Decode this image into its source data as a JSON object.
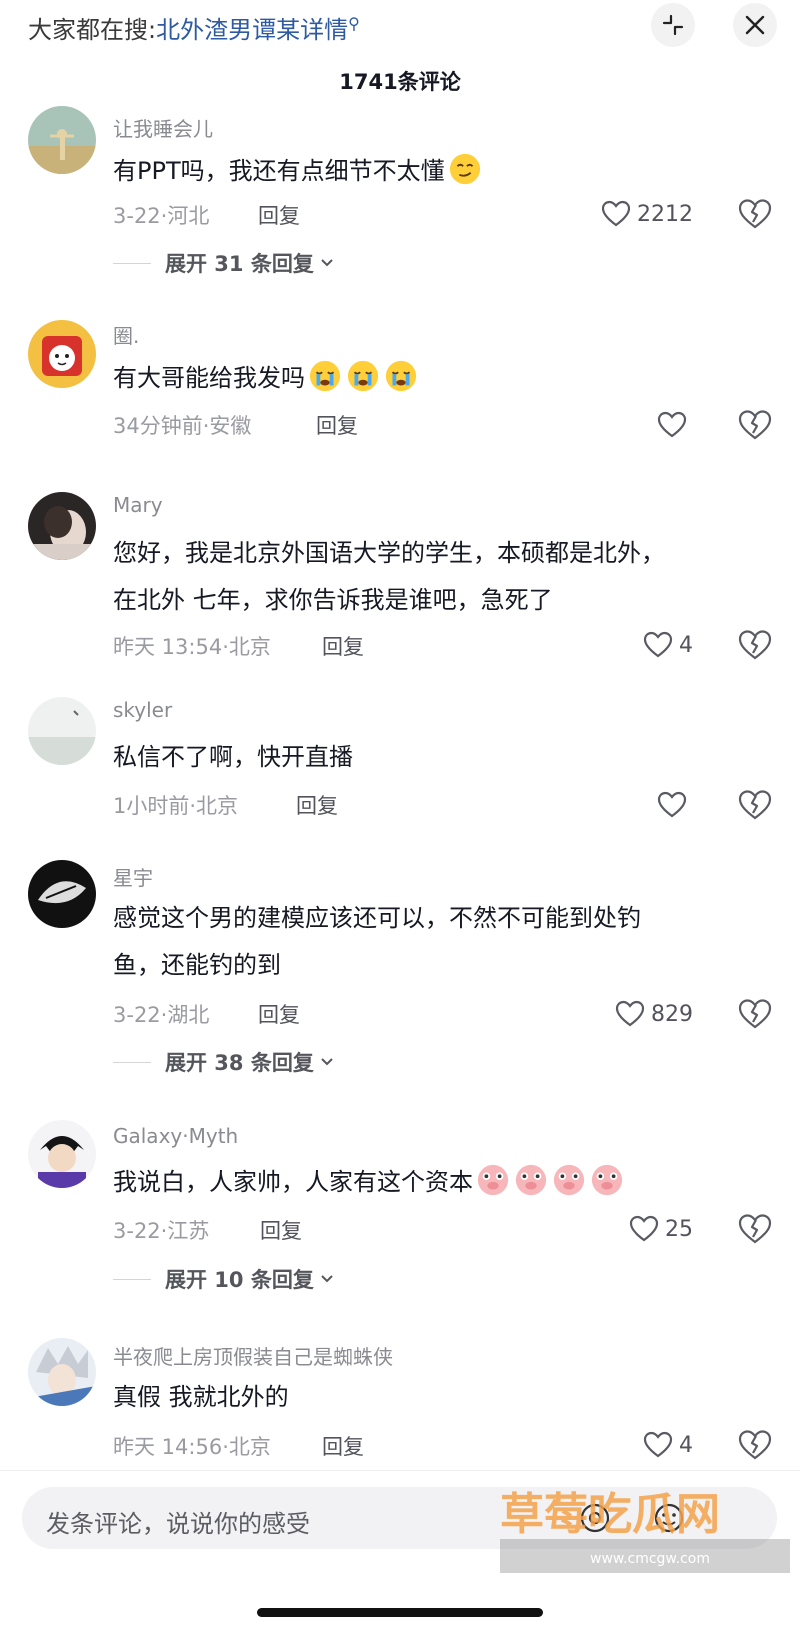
{
  "header": {
    "search_prefix": "大家都在搜:",
    "search_query": "北外渣男谭某详情",
    "comment_count": "1741条评论"
  },
  "comments": [
    {
      "username": "让我睡会儿",
      "text": "有PPT吗，我还有点细节不太懂",
      "emojis": [
        "smirk-face-emoji"
      ],
      "date": "3-22·河北",
      "reply": "回复",
      "likes": "2212",
      "expand": "展开 31 条回复"
    },
    {
      "username": "圈.",
      "text": "有大哥能给我发吗",
      "emojis": [
        "crying-face-emoji",
        "crying-face-emoji",
        "crying-face-emoji"
      ],
      "date": "34分钟前·安徽",
      "reply": "回复",
      "likes": ""
    },
    {
      "username": "Mary",
      "text_line1": "您好，我是北京外国语大学的学生，本硕都是北外，",
      "text_line2": "在北外 七年，求你告诉我是谁吧，急死了",
      "date": "昨天 13:54·北京",
      "reply": "回复",
      "likes": "4"
    },
    {
      "username": "skyler",
      "text": "私信不了啊，快开直播",
      "date": "1小时前·北京",
      "reply": "回复",
      "likes": ""
    },
    {
      "username": "星宇",
      "text_line1": "感觉这个男的建模应该还可以，不然不可能到处钓",
      "text_line2": "鱼，还能钓的到",
      "date": "3-22·湖北",
      "reply": "回复",
      "likes": "829",
      "expand": "展开 38 条回复"
    },
    {
      "username": "Galaxy·Myth",
      "text": "我说白，人家帅，人家有这个资本",
      "emojis": [
        "pig-face-emoji",
        "pig-face-emoji",
        "pig-face-emoji",
        "pig-face-emoji"
      ],
      "date": "3-22·江苏",
      "reply": "回复",
      "likes": "25",
      "expand": "展开 10 条回复"
    },
    {
      "username": "半夜爬上房顶假装自己是蜘蛛侠",
      "text": "真假 我就北外的",
      "date": "昨天 14:56·北京",
      "reply": "回复",
      "likes": "4"
    }
  ],
  "composer": {
    "placeholder": "发条评论，说说你的感受"
  },
  "watermark": {
    "brand": "草莓吃瓜网",
    "url": "www.cmcgw.com"
  },
  "colors": {
    "link_blue": "#2d5aa0",
    "text_primary": "#161823",
    "text_secondary": "#9a9ba1"
  }
}
